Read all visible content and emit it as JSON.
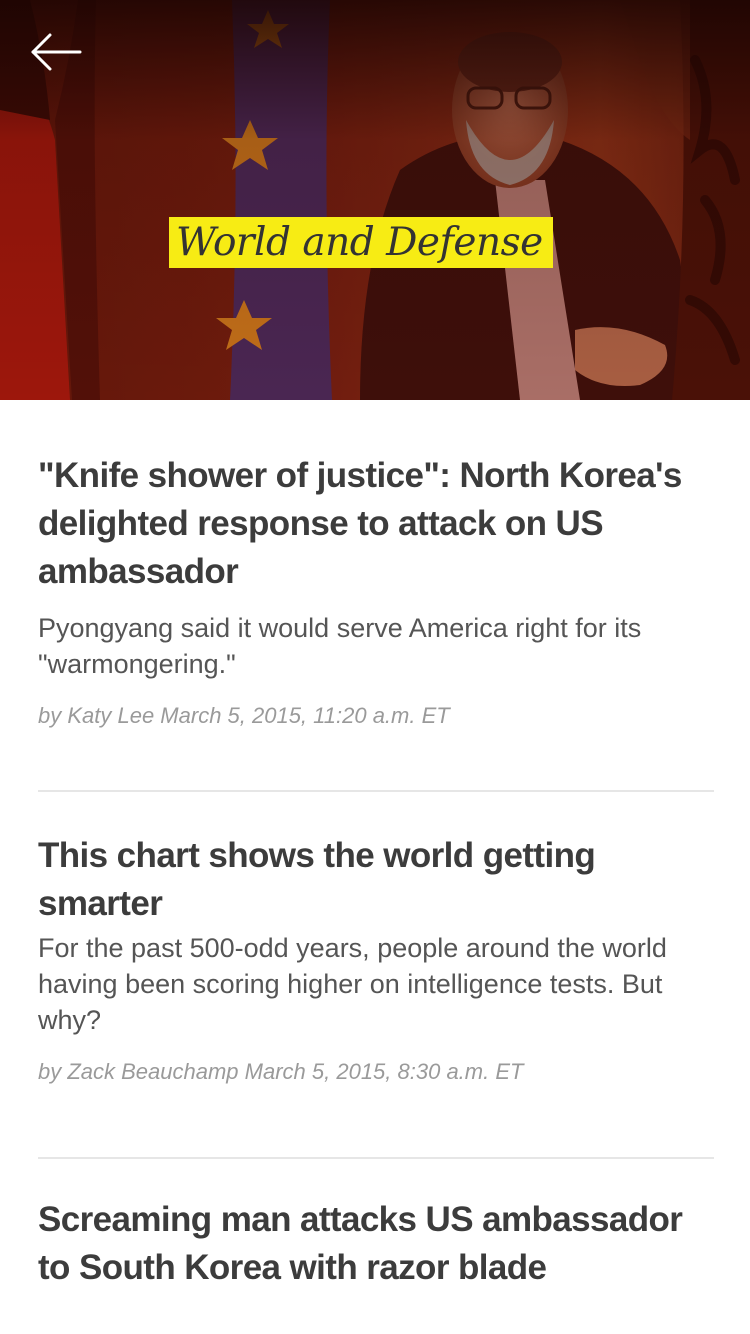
{
  "header": {
    "back_icon": "arrow-left-icon",
    "section_title": "World and Defense"
  },
  "articles": [
    {
      "title": "\"Knife shower of justice\": North Korea's delighted response to attack on US ambassador",
      "dek": "Pyongyang said it would serve America right for its \"warmongering.\"",
      "byline": "by Katy Lee March 5, 2015, 11:20 a.m. ET"
    },
    {
      "title": "This chart shows the world getting smarter",
      "dek": "For the past 500-odd years, people around the world having been scoring higher on intelligence tests. But why?",
      "byline": "by Zack Beauchamp March 5, 2015, 8:30 a.m. ET"
    },
    {
      "title": "Screaming man attacks US ambassador to South Korea with razor blade",
      "dek": "",
      "byline": ""
    }
  ],
  "colors": {
    "badge": "#f7ec14",
    "title_text": "#3c3c3c",
    "dek_text": "#555555",
    "byline_text": "#9a9a9a",
    "divider": "#e6e6e6"
  }
}
